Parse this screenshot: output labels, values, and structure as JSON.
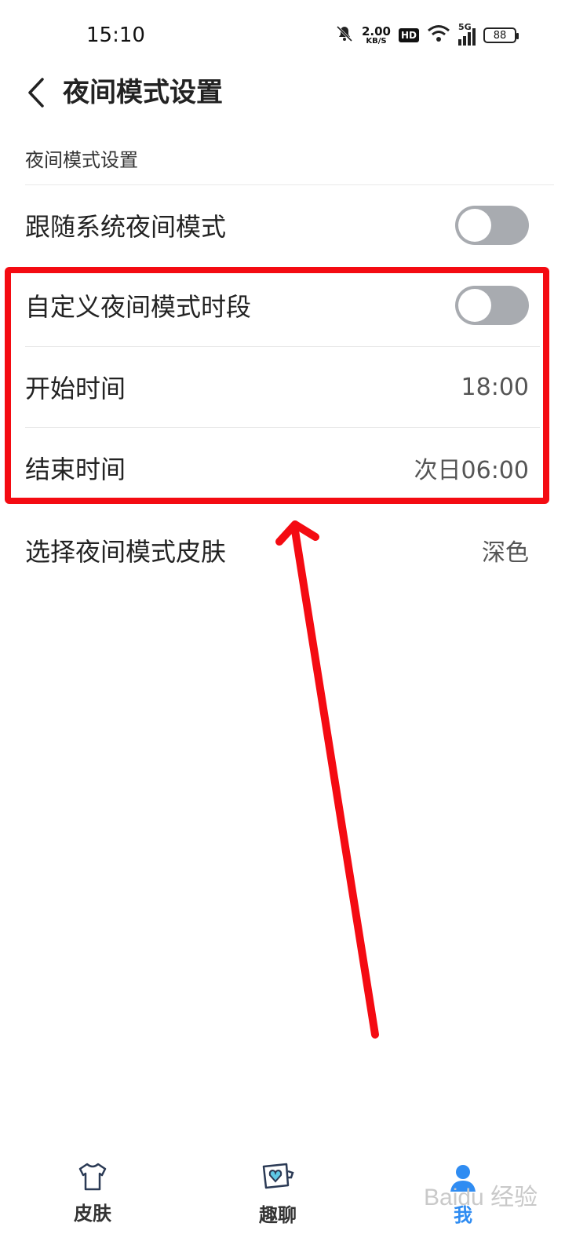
{
  "status_bar": {
    "time": "15:10",
    "net_speed_value": "2.00",
    "net_speed_unit": "KB/S",
    "hd_label": "HD",
    "signal_label": "5G",
    "battery_level": "88"
  },
  "header": {
    "title": "夜间模式设置"
  },
  "section": {
    "label": "夜间模式设置"
  },
  "settings": {
    "follow_system": {
      "label": "跟随系统夜间模式",
      "enabled": false
    },
    "custom_period": {
      "label": "自定义夜间模式时段",
      "enabled": false
    },
    "start_time": {
      "label": "开始时间",
      "value": "18:00"
    },
    "end_time": {
      "label": "结束时间",
      "value": "次日06:00"
    },
    "skin": {
      "label": "选择夜间模式皮肤",
      "value": "深色"
    }
  },
  "bottom_nav": {
    "items": [
      {
        "label": "皮肤",
        "icon": "tshirt-icon"
      },
      {
        "label": "趣聊",
        "icon": "chat-heart-icon"
      },
      {
        "label": "我",
        "icon": "profile-icon"
      }
    ],
    "active_index": 2
  },
  "watermark": "Baidu 经验",
  "colors": {
    "annotation_red": "#f40b12",
    "toggle_off": "#a8abb0",
    "accent_blue": "#2f8cf2"
  }
}
